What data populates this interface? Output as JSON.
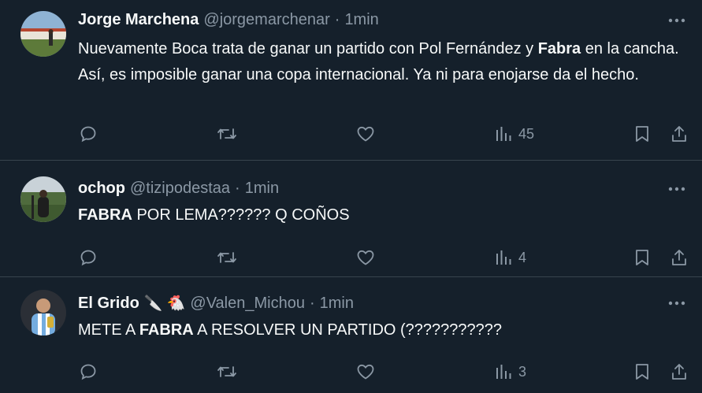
{
  "tweets": [
    {
      "name": "Jorge Marchena",
      "handle": "@jorgemarchenar",
      "separator": "·",
      "time": "1min",
      "text_parts": [
        "Nuevamente Boca trata de ganar un partido con Pol Fernández y ",
        "Fabra",
        " en la cancha. Así, es imposible ganar una copa internacional. Ya ni para enojarse da el hecho."
      ],
      "views": "45"
    },
    {
      "name": "ochop",
      "handle": "@tizipodestaa",
      "separator": "·",
      "time": "1min",
      "text_parts": [
        "FABRA",
        " POR LEMA?????? Q COÑOS"
      ],
      "views": "4"
    },
    {
      "name": "El Grido",
      "name_emojis": "🔪 🐔",
      "handle": "@Valen_Michou",
      "separator": "·",
      "time": "1min",
      "text_parts": [
        "METE A ",
        "FABRA",
        " A RESOLVER UN PARTIDO (???????????"
      ],
      "views": "3"
    }
  ],
  "icons": {
    "reply": "reply-icon",
    "retweet": "retweet-icon",
    "like": "heart-icon",
    "views": "views-icon",
    "bookmark": "bookmark-icon",
    "share": "share-icon",
    "more": "more-icon"
  },
  "colors": {
    "background": "#15202b",
    "text": "#f7f9f9",
    "muted": "#8b98a5",
    "divider": "#38444d"
  }
}
